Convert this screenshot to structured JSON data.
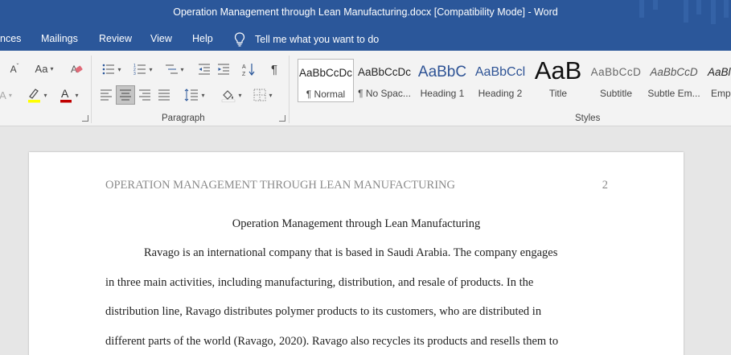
{
  "window": {
    "title": "Operation Management through Lean Manufacturing.docx [Compatibility Mode]  -  Word"
  },
  "tabs": [
    {
      "label": "nces"
    },
    {
      "label": "Mailings"
    },
    {
      "label": "Review"
    },
    {
      "label": "View"
    },
    {
      "label": "Help"
    }
  ],
  "tell_me": {
    "label": "Tell me what you want to do"
  },
  "ribbon": {
    "font_group": {
      "change_case": "Aa",
      "font_color_hex": "#c00000",
      "highlight_hex": "#ffff00"
    },
    "paragraph_group": {
      "label": "Paragraph",
      "show_marks": "¶"
    },
    "styles_group": {
      "label": "Styles",
      "styles": [
        {
          "sample": "AaBbCcDc",
          "name": "¶ Normal",
          "selected": true
        },
        {
          "sample": "AaBbCcDc",
          "name": "¶ No Spac..."
        },
        {
          "sample": "AaBbC",
          "name": "Heading 1"
        },
        {
          "sample": "AaBbCcl",
          "name": "Heading 2"
        },
        {
          "sample": "AaB",
          "name": "Title"
        },
        {
          "sample": "AaBbCcD",
          "name": "Subtitle"
        },
        {
          "sample": "AaBbCcD",
          "name": "Subtle Em..."
        },
        {
          "sample": "AaBl",
          "name": "Emp"
        }
      ]
    }
  },
  "document": {
    "running_head": "OPERATION MANAGEMENT THROUGH LEAN MANUFACTURING",
    "page_number": "2",
    "title": "Operation Management through Lean Manufacturing",
    "lines": [
      "Ravago is an international company that is based in Saudi Arabia. The company engages",
      "in three main activities, including manufacturing, distribution, and resale of products. In the",
      "distribution line, Ravago distributes polymer products to its customers, who are distributed in",
      "different parts of the world (Ravago, 2020). Ravago also recycles its products and resells them to"
    ]
  }
}
